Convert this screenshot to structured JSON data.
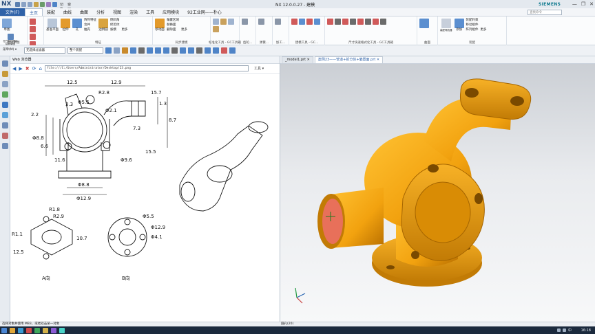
{
  "app": {
    "logo": "NX",
    "window_title": "NX 12.0.0.27 - 建模",
    "brand": "SIEMENS",
    "quick_access_label": "切换窗口",
    "window_menu_label": "窗口 ▾",
    "window_controls": [
      "—",
      "❐",
      "✕"
    ]
  },
  "menubar": {
    "file_label": "文件(F)",
    "tabs": [
      "主页",
      "装配",
      "曲线",
      "曲面",
      "分析",
      "视图",
      "渲染",
      "工具",
      "应用模块",
      "92工业网——朴心"
    ],
    "active_tab": "主页",
    "search_placeholder": "查找命令"
  },
  "ribbon": {
    "groups": [
      {
        "label": "直接草图",
        "items": [
          "草图",
          "在任务环境中绘制草图"
        ]
      },
      {
        "label": "特征",
        "items": [
          "基准平面",
          "拉伸",
          "孔",
          "阵列特征",
          "合并",
          "抽壳",
          "边倒圆",
          "倒斜角",
          "修剪体",
          "拔模",
          "更多"
        ]
      },
      {
        "label": "同步建模",
        "items": [
          "移动面",
          "偏置区域",
          "替换面",
          "删除面",
          "更多"
        ]
      },
      {
        "label": "标准化工具 - GC工具箱",
        "items": []
      },
      {
        "label": "齿轮...",
        "items": []
      },
      {
        "label": "弹簧...",
        "items": []
      },
      {
        "label": "加工...",
        "items": []
      },
      {
        "label": "建模工具 - GC...",
        "items": []
      },
      {
        "label": "尺寸快速格式化工具 - GC工具箱",
        "items": []
      },
      {
        "label": "曲面",
        "items": [
          "曲面"
        ]
      },
      {
        "label": "装配",
        "items": [
          "装配导航器",
          "添加",
          "装配约束",
          "移动组件",
          "阵列组件",
          "更多"
        ]
      }
    ]
  },
  "toolbar2": {
    "menu_label": "菜单(M) ▾",
    "filter_value": "无选择过滤器",
    "scope_value": "整个装配"
  },
  "web_pane": {
    "title": "Web 浏览器",
    "url": "file:///C:/Users/Administrator/Desktop/23.png",
    "tools_label": "工具 ▾"
  },
  "drawing": {
    "dims_top": [
      "12.5",
      "12.9",
      "R2.8",
      "Φ5.5",
      "Φ2.1",
      "1.3",
      "3.3",
      "2.2",
      "7.3",
      "15.7",
      "8.7",
      "Φ8.8",
      "6.6",
      "11.6",
      "15.5",
      "Φ9.6",
      "Φ8.8",
      "Φ12.9",
      "R1.8",
      "R2.9"
    ],
    "dims_bottom_left": [
      "R1.1",
      "12.5",
      "10.7",
      "A向"
    ],
    "dims_bottom_right": [
      "Φ5.5",
      "Φ12.9",
      "Φ4.1",
      "B向"
    ]
  },
  "viewport": {
    "tabs": [
      "_model1.prt ✕",
      "案例23——管道+拆分体+偏置面.prt ✕"
    ],
    "active_tab_index": 1,
    "part_color": "#f2a20f",
    "bore_color": "#e8705a"
  },
  "status": {
    "left": "选择对象并使用 MB3，或者双击某一对象",
    "right": "圆孔(20)"
  },
  "taskbar": {
    "time": "16:18",
    "ime": "中"
  },
  "colors": {
    "accent": "#2f62a8",
    "taskbar": "#1b2a3d"
  }
}
